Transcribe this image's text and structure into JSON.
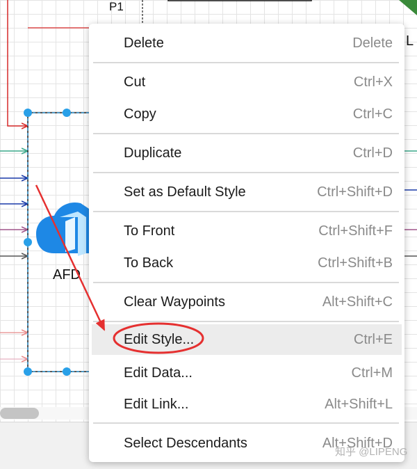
{
  "canvas": {
    "p1_label": "P1",
    "afd_label": "AFD",
    "right_edge_letter": "L"
  },
  "context_menu": {
    "items": [
      {
        "label": "Delete",
        "shortcut": "Delete"
      },
      {
        "label": "Cut",
        "shortcut": "Ctrl+X"
      },
      {
        "label": "Copy",
        "shortcut": "Ctrl+C"
      },
      {
        "label": "Duplicate",
        "shortcut": "Ctrl+D"
      },
      {
        "label": "Set as Default Style",
        "shortcut": "Ctrl+Shift+D"
      },
      {
        "label": "To Front",
        "shortcut": "Ctrl+Shift+F"
      },
      {
        "label": "To Back",
        "shortcut": "Ctrl+Shift+B"
      },
      {
        "label": "Clear Waypoints",
        "shortcut": "Alt+Shift+C"
      },
      {
        "label": "Edit Style...",
        "shortcut": "Ctrl+E"
      },
      {
        "label": "Edit Data...",
        "shortcut": "Ctrl+M"
      },
      {
        "label": "Edit Link...",
        "shortcut": "Alt+Shift+L"
      },
      {
        "label": "Select Descendants",
        "shortcut": "Alt+Shift+D"
      }
    ],
    "highlighted_item": "Edit Style..."
  },
  "watermark": "知乎 @LIPENG",
  "colors": {
    "selection_handle": "#29a0e8",
    "annotation_red": "#e53030",
    "menu_highlight": "#ececec",
    "icon_blue": "#1e88e5"
  },
  "icons": [
    "azure-front-door-icon",
    "red-arrow-annotation",
    "red-ellipse-annotation"
  ]
}
